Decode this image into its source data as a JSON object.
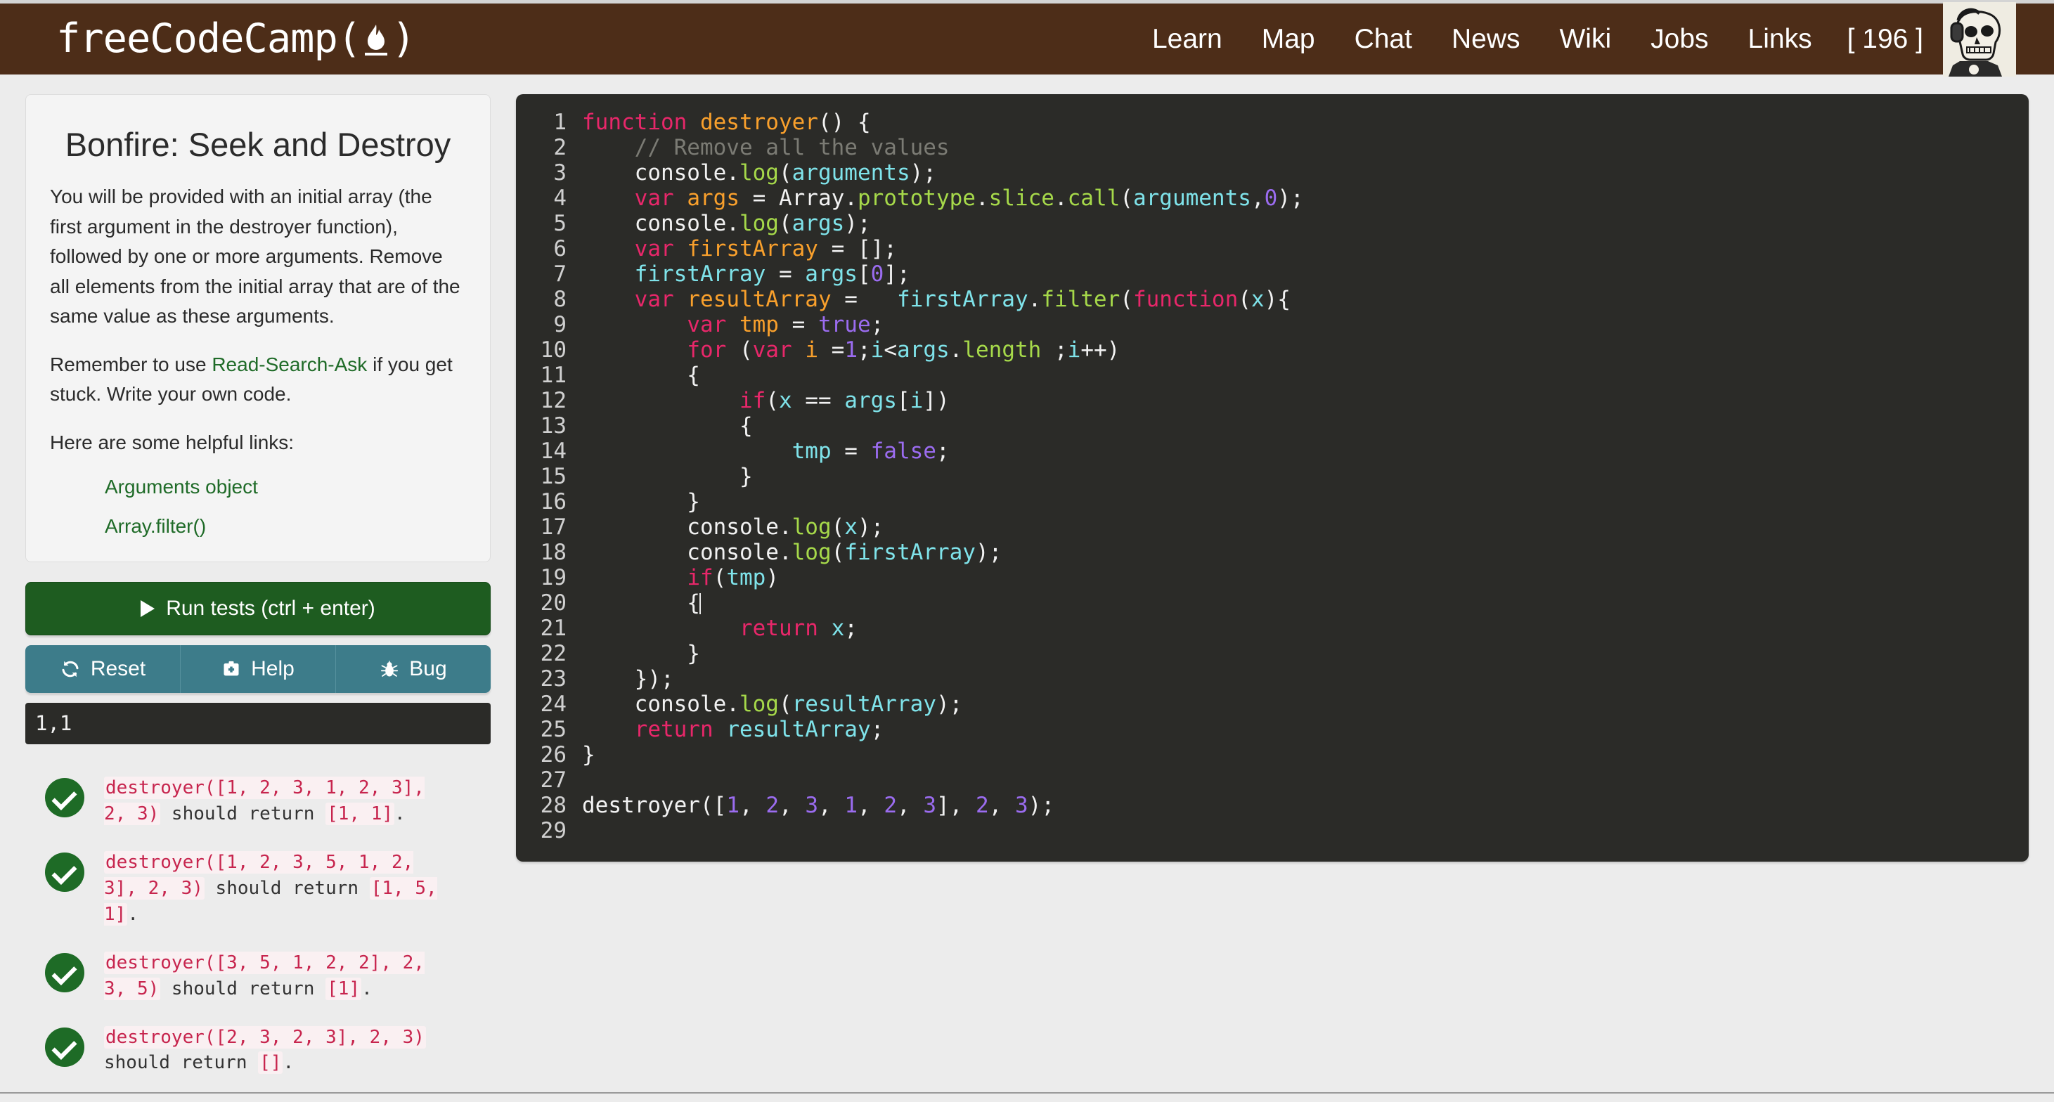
{
  "nav": {
    "brand": "freeCodeCamp",
    "brand_paren_open": "(",
    "brand_paren_close": ")",
    "brand_flame_icon": "flame-icon",
    "links": [
      {
        "label": "Learn"
      },
      {
        "label": "Map"
      },
      {
        "label": "Chat"
      },
      {
        "label": "News"
      },
      {
        "label": "Wiki"
      },
      {
        "label": "Jobs"
      },
      {
        "label": "Links"
      }
    ],
    "brownie_points": "[ 196 ]",
    "avatar_alt": "skull-with-headphones-avatar",
    "bg_color": "#4d2d18"
  },
  "challenge": {
    "title": "Bonfire: Seek and Destroy",
    "paragraph_1": "You will be provided with an initial array (the first argument in the destroyer function), followed by one or more arguments. Remove all elements from the initial array that are of the same value as these arguments.",
    "paragraph_2_before": "Remember to use ",
    "paragraph_2_link": "Read-Search-Ask",
    "paragraph_2_after": " if you get stuck. Write your own code.",
    "paragraph_3": "Here are some helpful links:",
    "links": [
      {
        "label": "Arguments object"
      },
      {
        "label": "Array.filter()"
      }
    ],
    "link_color": "#1f6b28"
  },
  "actions": {
    "run_label": "Run tests (ctrl + enter)",
    "run_icon": "play-icon",
    "run_color": "#1e5c20",
    "secondary": [
      {
        "label": "Reset",
        "icon": "refresh-icon"
      },
      {
        "label": "Help",
        "icon": "first-aid-kit-icon"
      },
      {
        "label": "Bug",
        "icon": "bug-icon"
      }
    ],
    "secondary_color": "#3d7c8a"
  },
  "console": {
    "output": "1,1"
  },
  "tests": [
    {
      "status": "pass",
      "icon": "check-circle-icon",
      "parts": [
        {
          "text": "destroyer([1, 2, 3, 1, 2, 3], 2, 3)",
          "code": true
        },
        {
          "text": " should return ",
          "code": false
        },
        {
          "text": "[1, 1]",
          "code": true
        },
        {
          "text": ".",
          "code": false
        }
      ]
    },
    {
      "status": "pass",
      "icon": "check-circle-icon",
      "parts": [
        {
          "text": "destroyer([1, 2, 3, 5, 1, 2, 3], 2, 3)",
          "code": true
        },
        {
          "text": " should return ",
          "code": false
        },
        {
          "text": "[1, 5, 1]",
          "code": true
        },
        {
          "text": ".",
          "code": false
        }
      ]
    },
    {
      "status": "pass",
      "icon": "check-circle-icon",
      "parts": [
        {
          "text": "destroyer([3, 5, 1, 2, 2], 2, 3, 5)",
          "code": true
        },
        {
          "text": " should return ",
          "code": false
        },
        {
          "text": "[1]",
          "code": true
        },
        {
          "text": ".",
          "code": false
        }
      ]
    },
    {
      "status": "pass",
      "icon": "check-circle-icon",
      "parts": [
        {
          "text": "destroyer([2, 3, 2, 3], 2, 3)",
          "code": true
        },
        {
          "text": " should return ",
          "code": false
        },
        {
          "text": "[]",
          "code": true
        },
        {
          "text": ".",
          "code": false
        }
      ]
    }
  ],
  "editor": {
    "background": "#2b2b28",
    "gutter_color": "#d0d0d0",
    "cursor_line": 20,
    "total_lines": 29,
    "lines": [
      {
        "n": 1,
        "tokens": [
          {
            "t": "function",
            "c": "kw"
          },
          {
            "t": " ",
            "c": "pun"
          },
          {
            "t": "destroyer",
            "c": "fn"
          },
          {
            "t": "() {",
            "c": "pun"
          }
        ]
      },
      {
        "n": 2,
        "tokens": [
          {
            "t": "    ",
            "c": "pun"
          },
          {
            "t": "// Remove all the values",
            "c": "cmt"
          }
        ]
      },
      {
        "n": 3,
        "tokens": [
          {
            "t": "    console.",
            "c": "pun"
          },
          {
            "t": "log",
            "c": "prop"
          },
          {
            "t": "(",
            "c": "pun"
          },
          {
            "t": "arguments",
            "c": "id"
          },
          {
            "t": ");",
            "c": "pun"
          }
        ]
      },
      {
        "n": 4,
        "tokens": [
          {
            "t": "    ",
            "c": "pun"
          },
          {
            "t": "var",
            "c": "kw"
          },
          {
            "t": " ",
            "c": "pun"
          },
          {
            "t": "args",
            "c": "var"
          },
          {
            "t": " = Array.",
            "c": "pun"
          },
          {
            "t": "prototype",
            "c": "prop"
          },
          {
            "t": ".",
            "c": "pun"
          },
          {
            "t": "slice",
            "c": "prop"
          },
          {
            "t": ".",
            "c": "pun"
          },
          {
            "t": "call",
            "c": "prop"
          },
          {
            "t": "(",
            "c": "pun"
          },
          {
            "t": "arguments",
            "c": "id"
          },
          {
            "t": ",",
            "c": "pun"
          },
          {
            "t": "0",
            "c": "num"
          },
          {
            "t": ");",
            "c": "pun"
          }
        ]
      },
      {
        "n": 5,
        "tokens": [
          {
            "t": "    console.",
            "c": "pun"
          },
          {
            "t": "log",
            "c": "prop"
          },
          {
            "t": "(",
            "c": "pun"
          },
          {
            "t": "args",
            "c": "id"
          },
          {
            "t": ");",
            "c": "pun"
          }
        ]
      },
      {
        "n": 6,
        "tokens": [
          {
            "t": "    ",
            "c": "pun"
          },
          {
            "t": "var",
            "c": "kw"
          },
          {
            "t": " ",
            "c": "pun"
          },
          {
            "t": "firstArray",
            "c": "var"
          },
          {
            "t": " = [];",
            "c": "pun"
          }
        ]
      },
      {
        "n": 7,
        "tokens": [
          {
            "t": "    ",
            "c": "pun"
          },
          {
            "t": "firstArray",
            "c": "id"
          },
          {
            "t": " = ",
            "c": "pun"
          },
          {
            "t": "args",
            "c": "id"
          },
          {
            "t": "[",
            "c": "pun"
          },
          {
            "t": "0",
            "c": "num"
          },
          {
            "t": "];",
            "c": "pun"
          }
        ]
      },
      {
        "n": 8,
        "tokens": [
          {
            "t": "    ",
            "c": "pun"
          },
          {
            "t": "var",
            "c": "kw"
          },
          {
            "t": " ",
            "c": "pun"
          },
          {
            "t": "resultArray",
            "c": "var"
          },
          {
            "t": " =   ",
            "c": "pun"
          },
          {
            "t": "firstArray",
            "c": "id"
          },
          {
            "t": ".",
            "c": "pun"
          },
          {
            "t": "filter",
            "c": "prop"
          },
          {
            "t": "(",
            "c": "pun"
          },
          {
            "t": "function",
            "c": "kw"
          },
          {
            "t": "(",
            "c": "pun"
          },
          {
            "t": "x",
            "c": "id"
          },
          {
            "t": "){",
            "c": "pun"
          }
        ]
      },
      {
        "n": 9,
        "tokens": [
          {
            "t": "        ",
            "c": "pun"
          },
          {
            "t": "var",
            "c": "kw"
          },
          {
            "t": " ",
            "c": "pun"
          },
          {
            "t": "tmp",
            "c": "var"
          },
          {
            "t": " = ",
            "c": "pun"
          },
          {
            "t": "true",
            "c": "atom"
          },
          {
            "t": ";",
            "c": "pun"
          }
        ]
      },
      {
        "n": 10,
        "tokens": [
          {
            "t": "        ",
            "c": "pun"
          },
          {
            "t": "for",
            "c": "kw"
          },
          {
            "t": " (",
            "c": "pun"
          },
          {
            "t": "var",
            "c": "kw"
          },
          {
            "t": " ",
            "c": "pun"
          },
          {
            "t": "i",
            "c": "var"
          },
          {
            "t": " =",
            "c": "pun"
          },
          {
            "t": "1",
            "c": "num"
          },
          {
            "t": ";",
            "c": "pun"
          },
          {
            "t": "i",
            "c": "id"
          },
          {
            "t": "<",
            "c": "pun"
          },
          {
            "t": "args",
            "c": "id"
          },
          {
            "t": ".",
            "c": "pun"
          },
          {
            "t": "length",
            "c": "prop"
          },
          {
            "t": " ;",
            "c": "pun"
          },
          {
            "t": "i",
            "c": "id"
          },
          {
            "t": "++)",
            "c": "pun"
          }
        ]
      },
      {
        "n": 11,
        "tokens": [
          {
            "t": "        {",
            "c": "pun"
          }
        ]
      },
      {
        "n": 12,
        "tokens": [
          {
            "t": "            ",
            "c": "pun"
          },
          {
            "t": "if",
            "c": "kw"
          },
          {
            "t": "(",
            "c": "pun"
          },
          {
            "t": "x",
            "c": "id"
          },
          {
            "t": " == ",
            "c": "pun"
          },
          {
            "t": "args",
            "c": "id"
          },
          {
            "t": "[",
            "c": "pun"
          },
          {
            "t": "i",
            "c": "id"
          },
          {
            "t": "])",
            "c": "pun"
          }
        ]
      },
      {
        "n": 13,
        "tokens": [
          {
            "t": "            {",
            "c": "pun"
          }
        ]
      },
      {
        "n": 14,
        "tokens": [
          {
            "t": "                ",
            "c": "pun"
          },
          {
            "t": "tmp",
            "c": "id"
          },
          {
            "t": " = ",
            "c": "pun"
          },
          {
            "t": "false",
            "c": "atom"
          },
          {
            "t": ";",
            "c": "pun"
          }
        ]
      },
      {
        "n": 15,
        "tokens": [
          {
            "t": "            }",
            "c": "pun"
          }
        ]
      },
      {
        "n": 16,
        "tokens": [
          {
            "t": "        }",
            "c": "pun"
          }
        ]
      },
      {
        "n": 17,
        "tokens": [
          {
            "t": "        console.",
            "c": "pun"
          },
          {
            "t": "log",
            "c": "prop"
          },
          {
            "t": "(",
            "c": "pun"
          },
          {
            "t": "x",
            "c": "id"
          },
          {
            "t": ");",
            "c": "pun"
          }
        ]
      },
      {
        "n": 18,
        "tokens": [
          {
            "t": "        console.",
            "c": "pun"
          },
          {
            "t": "log",
            "c": "prop"
          },
          {
            "t": "(",
            "c": "pun"
          },
          {
            "t": "firstArray",
            "c": "id"
          },
          {
            "t": ");",
            "c": "pun"
          }
        ]
      },
      {
        "n": 19,
        "tokens": [
          {
            "t": "        ",
            "c": "pun"
          },
          {
            "t": "if",
            "c": "kw"
          },
          {
            "t": "(",
            "c": "pun"
          },
          {
            "t": "tmp",
            "c": "id"
          },
          {
            "t": ")",
            "c": "pun"
          }
        ]
      },
      {
        "n": 20,
        "tokens": [
          {
            "t": "        {",
            "c": "pun"
          }
        ]
      },
      {
        "n": 21,
        "tokens": [
          {
            "t": "            ",
            "c": "pun"
          },
          {
            "t": "return",
            "c": "kw"
          },
          {
            "t": " ",
            "c": "pun"
          },
          {
            "t": "x",
            "c": "id"
          },
          {
            "t": ";",
            "c": "pun"
          }
        ]
      },
      {
        "n": 22,
        "tokens": [
          {
            "t": "        }",
            "c": "pun"
          }
        ]
      },
      {
        "n": 23,
        "tokens": [
          {
            "t": "    });",
            "c": "pun"
          }
        ]
      },
      {
        "n": 24,
        "tokens": [
          {
            "t": "    console.",
            "c": "pun"
          },
          {
            "t": "log",
            "c": "prop"
          },
          {
            "t": "(",
            "c": "pun"
          },
          {
            "t": "resultArray",
            "c": "id"
          },
          {
            "t": ");",
            "c": "pun"
          }
        ]
      },
      {
        "n": 25,
        "tokens": [
          {
            "t": "    ",
            "c": "pun"
          },
          {
            "t": "return",
            "c": "kw"
          },
          {
            "t": " ",
            "c": "pun"
          },
          {
            "t": "resultArray",
            "c": "id"
          },
          {
            "t": ";",
            "c": "pun"
          }
        ]
      },
      {
        "n": 26,
        "tokens": [
          {
            "t": "}",
            "c": "pun"
          }
        ]
      },
      {
        "n": 27,
        "tokens": []
      },
      {
        "n": 28,
        "tokens": [
          {
            "t": "destroyer([",
            "c": "pun"
          },
          {
            "t": "1",
            "c": "num"
          },
          {
            "t": ", ",
            "c": "pun"
          },
          {
            "t": "2",
            "c": "num"
          },
          {
            "t": ", ",
            "c": "pun"
          },
          {
            "t": "3",
            "c": "num"
          },
          {
            "t": ", ",
            "c": "pun"
          },
          {
            "t": "1",
            "c": "num"
          },
          {
            "t": ", ",
            "c": "pun"
          },
          {
            "t": "2",
            "c": "num"
          },
          {
            "t": ", ",
            "c": "pun"
          },
          {
            "t": "3",
            "c": "num"
          },
          {
            "t": "], ",
            "c": "pun"
          },
          {
            "t": "2",
            "c": "num"
          },
          {
            "t": ", ",
            "c": "pun"
          },
          {
            "t": "3",
            "c": "num"
          },
          {
            "t": ");",
            "c": "pun"
          }
        ]
      },
      {
        "n": 29,
        "tokens": []
      }
    ]
  }
}
